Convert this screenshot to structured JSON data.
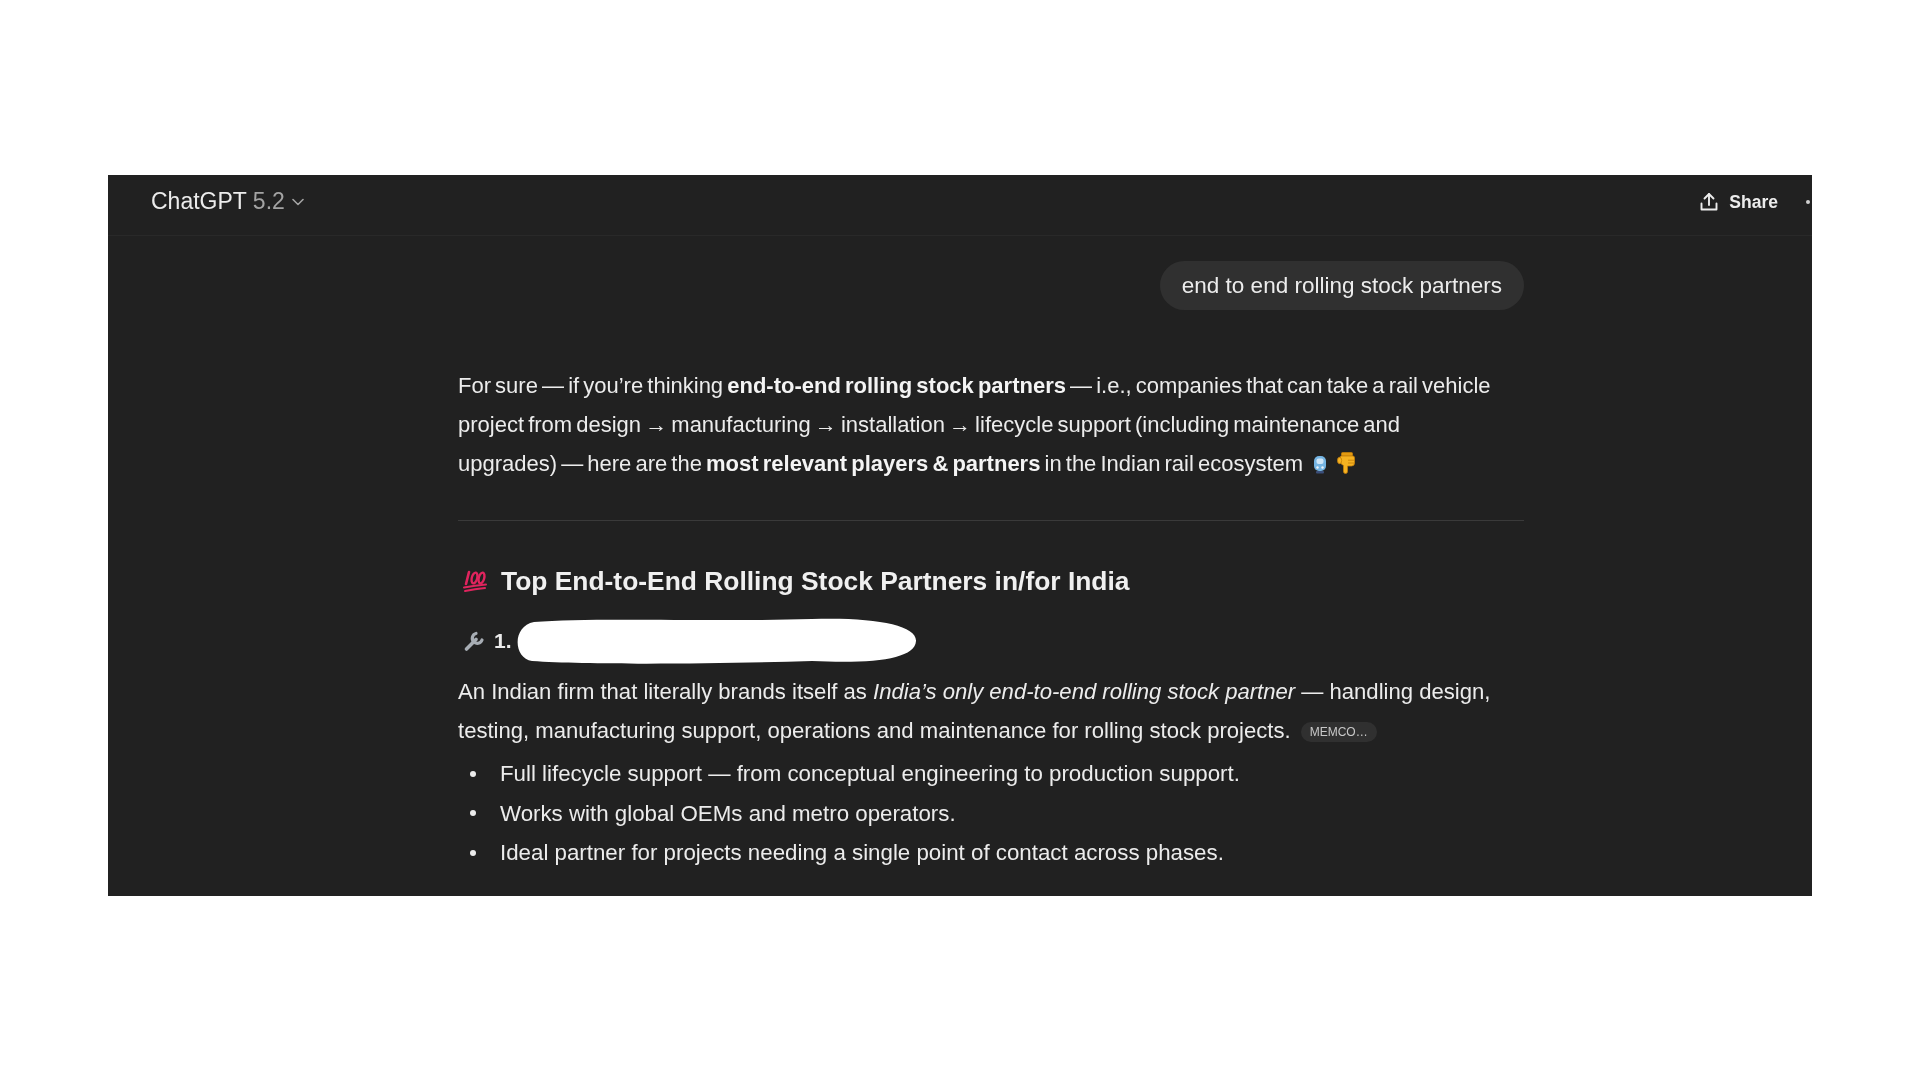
{
  "header": {
    "model_name": "ChatGPT",
    "model_version": "5.2",
    "share_label": "Share"
  },
  "user_message": "end to end rolling stock partners",
  "response": {
    "intro": "For sure — if you’re thinking **end-to-end rolling stock partners** — i.e., companies that can take a rail vehicle project from design → manufacturing → installation → lifecycle support (including maintenance and upgrades) — here are the **most relevant players & partners** in the Indian rail ecosystem",
    "section_heading": "Top End-to-End Rolling Stock Partners in/for India",
    "entries": [
      {
        "number": "1.",
        "name_redacted": true,
        "description": "An Indian firm that literally brands itself as *India’s only end-to-end rolling stock partner* — handling design, testing, manufacturing support, operations and maintenance for rolling stock projects.",
        "citation": "MEMCO…",
        "bullets": [
          "Full lifecycle support — from conceptual engineering to production support.",
          "Works with global OEMs and metro operators.",
          "Ideal partner for projects needing a single point of contact across phases."
        ]
      }
    ]
  }
}
